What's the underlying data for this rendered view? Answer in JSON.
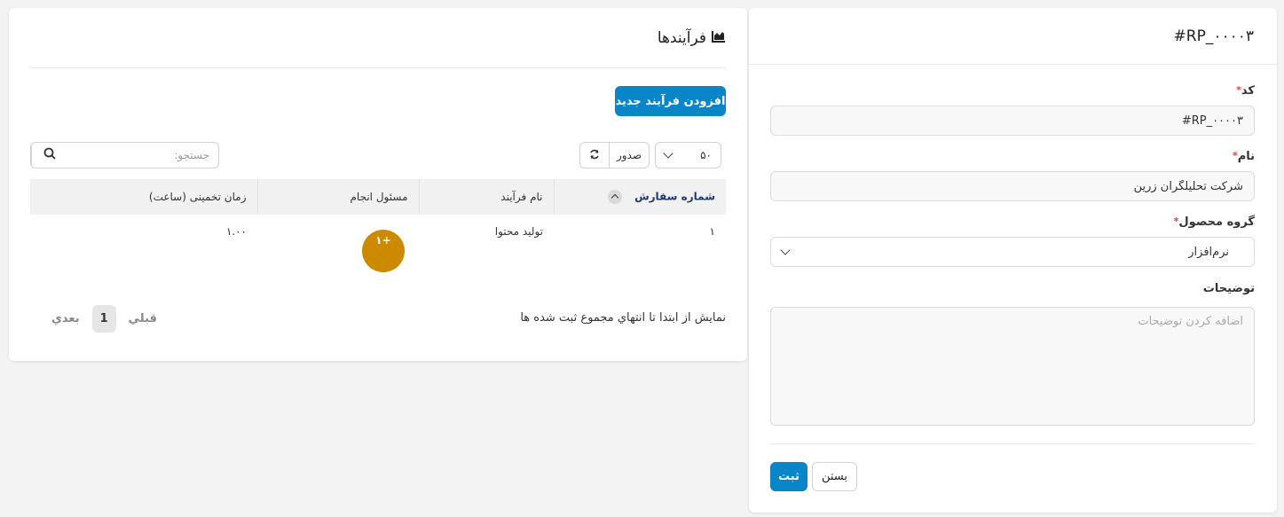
{
  "form": {
    "header_title": "#RP_۰۰۰۰۳",
    "code": {
      "label": "کد",
      "value": "#RP_۰۰۰۰۳"
    },
    "name": {
      "label": "نام",
      "value": "شرکت تحلیلگران زرین"
    },
    "product_group": {
      "label": "گروه محصول",
      "selected": "نرم‌افزار"
    },
    "description": {
      "label": "توضیحات",
      "placeholder": "اضافه کردن توضیحات",
      "value": ""
    },
    "required_mark": "*",
    "buttons": {
      "submit": "ثبت",
      "close": "بستن"
    }
  },
  "list": {
    "title": "فرآیندها",
    "add_button": "افزودن فرآیند جدید",
    "page_size": "۵۰",
    "export_label": "صدور",
    "search_placeholder": "جستجو:",
    "columns": [
      "شماره سفارش",
      "نام فرآیند",
      "مسئول انجام",
      "زمان تخمینی (ساعت)"
    ],
    "rows": [
      {
        "order_no": "۱",
        "process_name": "تولید محتوا",
        "assignee_badge": "۱+",
        "estimated_hours": "۱.۰۰"
      }
    ],
    "footer_info": "نمایش از ابتدا تا انتهاي مجموع ثبت شده ها",
    "pagination": {
      "prev": "قبلي",
      "current": "1",
      "next": "بعدي"
    }
  },
  "colors": {
    "primary": "#0a85c8",
    "badge": "#cc8a00",
    "sorted_header": "#1e3a6d",
    "required": "#e03b3b"
  }
}
